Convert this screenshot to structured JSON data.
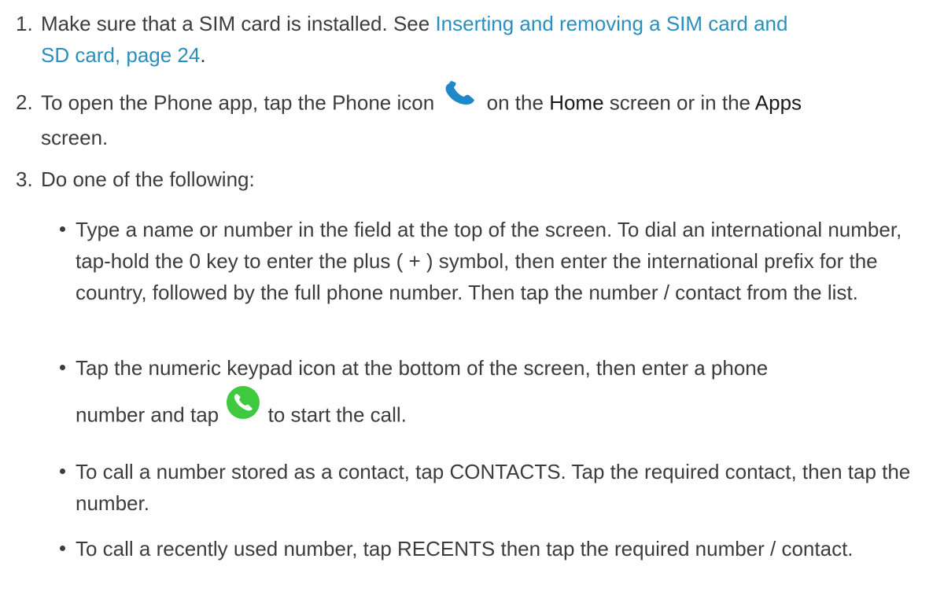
{
  "steps": [
    {
      "number": "1.",
      "text_before": "Make sure that a SIM card is installed. See ",
      "link_line1": "Inserting and removing a SIM card and",
      "link_line2": "SD card, page 24",
      "text_after": "."
    },
    {
      "number": "2.",
      "text_before": "To open the Phone app, tap the Phone icon",
      "icon": "phone-handset-icon",
      "text_middle": "on the",
      "home": "Home",
      "text_middle2": "screen or in the",
      "apps": "Apps",
      "text_after": "screen."
    },
    {
      "number": "3.",
      "text": "Do one of the following:"
    }
  ],
  "bullets": [
    {
      "text": "Type a name or number in the field at the top of the screen. To dial an international number, tap-hold the 0 key to enter the plus ( + ) symbol, then enter the international prefix for the country, followed by the full phone number. Then tap the number / contact from the list."
    },
    {
      "text_before": "Tap the numeric keypad icon at the bottom of the screen, then enter a phone",
      "text_line2": "number and tap",
      "icon": "green-call-button-icon",
      "text_after": "to start the call."
    },
    {
      "text": "To call a number stored as a contact, tap CONTACTS. Tap the required contact, then tap the number."
    },
    {
      "text": "To call a recently used number, tap RECENTS then tap the required number / contact."
    }
  ],
  "colors": {
    "text": "#3c3c3c",
    "link": "#2a8fbf",
    "phone_icon": "#1e88c8",
    "call_button": "#3fc93f"
  }
}
